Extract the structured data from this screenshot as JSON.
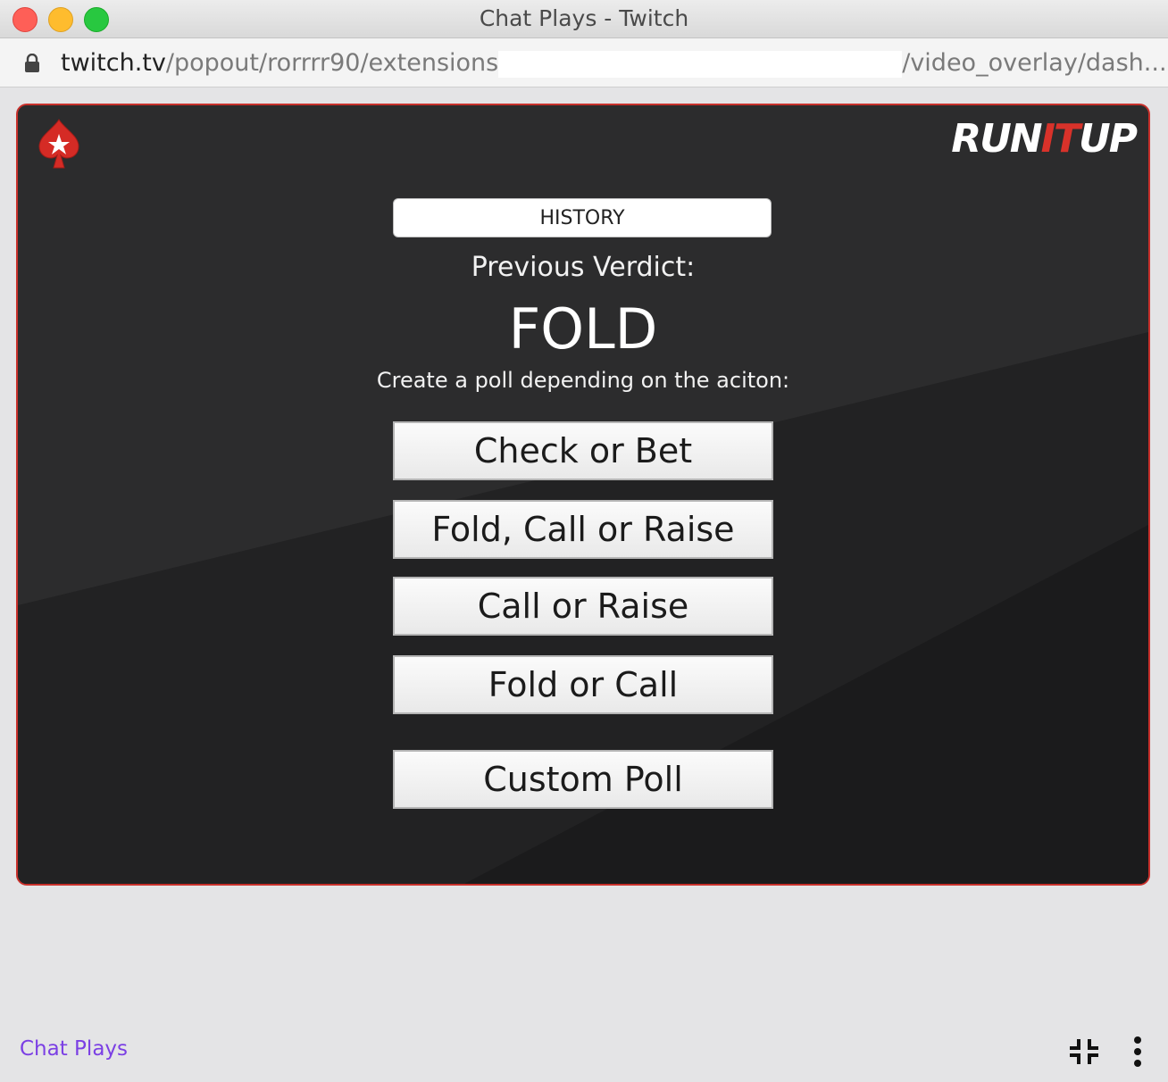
{
  "window": {
    "title": "Chat Plays - Twitch"
  },
  "address_bar": {
    "host": "twitch.tv",
    "path_start": "/popout/rorrrr90/extensions",
    "path_end": "/video_overlay/dash..."
  },
  "panel": {
    "brand_logo": {
      "part1": "RUN",
      "part2": "IT",
      "part3": "UP"
    },
    "history_label": "HISTORY",
    "verdict_label": "Previous Verdict:",
    "verdict_value": "FOLD",
    "instructions": "Create a poll depending on the aciton:",
    "poll_buttons": [
      {
        "label": "Check or Bet"
      },
      {
        "label": "Fold, Call or Raise"
      },
      {
        "label": "Call or Raise"
      },
      {
        "label": "Fold or Call"
      },
      {
        "label": "Custom Poll"
      }
    ],
    "colors": {
      "border": "#c8302b",
      "accent": "#d8322a",
      "background": "#2b2b2c"
    }
  },
  "footer": {
    "extension_name": "Chat Plays",
    "icons": [
      "collapse-icon",
      "more-options-icon"
    ],
    "colors": {
      "link": "#7b3fe4"
    }
  }
}
